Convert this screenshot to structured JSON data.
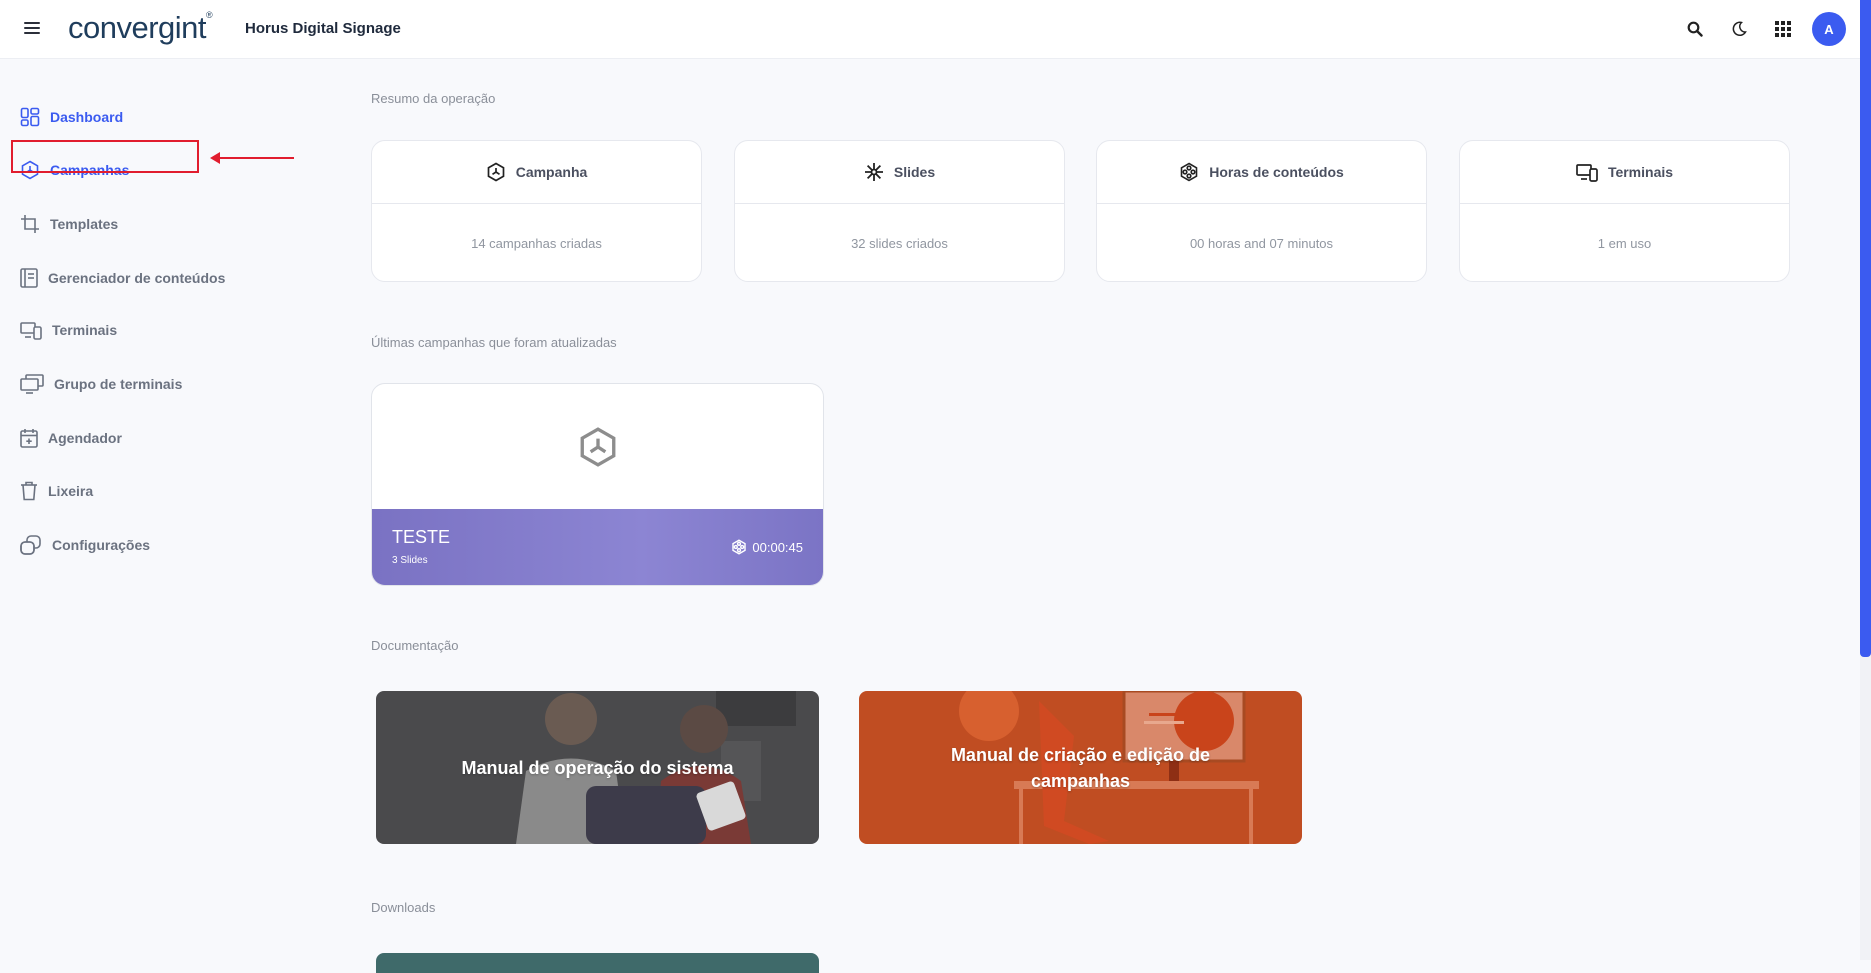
{
  "header": {
    "logo_text": "convergint",
    "app_title": "Horus Digital Signage",
    "avatar_initial": "A"
  },
  "icons": {
    "menu": "hamburger-icon",
    "search": "search-icon",
    "theme": "moon-icon",
    "apps": "grid-icon"
  },
  "colors": {
    "accent": "#3b5bf0",
    "annotation": "#e11d2e"
  },
  "sidebar": {
    "items": [
      {
        "label": "Dashboard",
        "icon": "dashboard-icon"
      },
      {
        "label": "Campanhas",
        "icon": "campaign-icon"
      },
      {
        "label": "Templates",
        "icon": "crop-icon"
      },
      {
        "label": "Gerenciador de conteúdos",
        "icon": "content-manager-icon"
      },
      {
        "label": "Terminais",
        "icon": "devices-icon"
      },
      {
        "label": "Grupo de terminais",
        "icon": "monitors-icon"
      },
      {
        "label": "Agendador",
        "icon": "calendar-icon"
      },
      {
        "label": "Lixeira",
        "icon": "trash-icon"
      },
      {
        "label": "Configurações",
        "icon": "settings-icon"
      }
    ]
  },
  "summary": {
    "title": "Resumo da operação",
    "cards": [
      {
        "title": "Campanha",
        "value": "14 campanhas criadas"
      },
      {
        "title": "Slides",
        "value": "32 slides criados"
      },
      {
        "title": "Horas de conteúdos",
        "value": "00 horas and 07 minutos"
      },
      {
        "title": "Terminais",
        "value": "1 em uso"
      }
    ]
  },
  "recent": {
    "title": "Últimas campanhas que foram atualizadas",
    "campaign": {
      "name": "TESTE",
      "slides": "3 Slides",
      "duration": "00:00:45"
    }
  },
  "documentation": {
    "title": "Documentação",
    "items": [
      {
        "label": "Manual de operação do sistema"
      },
      {
        "label": "Manual de criação e edição de campanhas"
      }
    ]
  },
  "downloads": {
    "title": "Downloads"
  }
}
